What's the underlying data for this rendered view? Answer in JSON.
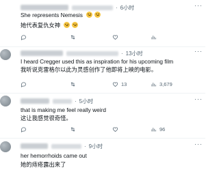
{
  "replies": [
    {
      "time": "6小时",
      "text_en": "She represents Nemesis",
      "text_zh": "她代表复仇女神",
      "emoji_count": 2,
      "actions": {
        "reply": "",
        "repost": "",
        "like": "",
        "views": ""
      }
    },
    {
      "time": "13小时",
      "text_en_line1": "I heard Cregger used this as inspiration for his upcoming film",
      "text_zh": "我听说克雷格尔以此为灵感创作了他即将上映的电影。",
      "actions": {
        "reply": "",
        "repost": "",
        "like": "13",
        "views": "3,679"
      }
    },
    {
      "time": "5小时",
      "text_en": "that is making me feel really weird",
      "text_zh": "这让我感觉很奇怪。",
      "actions": {
        "reply": "",
        "repost": "",
        "like": "",
        "views": "96"
      }
    },
    {
      "time": "9小时",
      "text_en": "her hemorrhoids came out",
      "text_zh": "她的痔疮露出来了"
    }
  ],
  "ui": {
    "more_label": "···",
    "separator": "·",
    "icons": [
      "reply-icon",
      "repost-icon",
      "like-icon",
      "views-icon",
      "bookmark-icon",
      "share-icon"
    ]
  }
}
